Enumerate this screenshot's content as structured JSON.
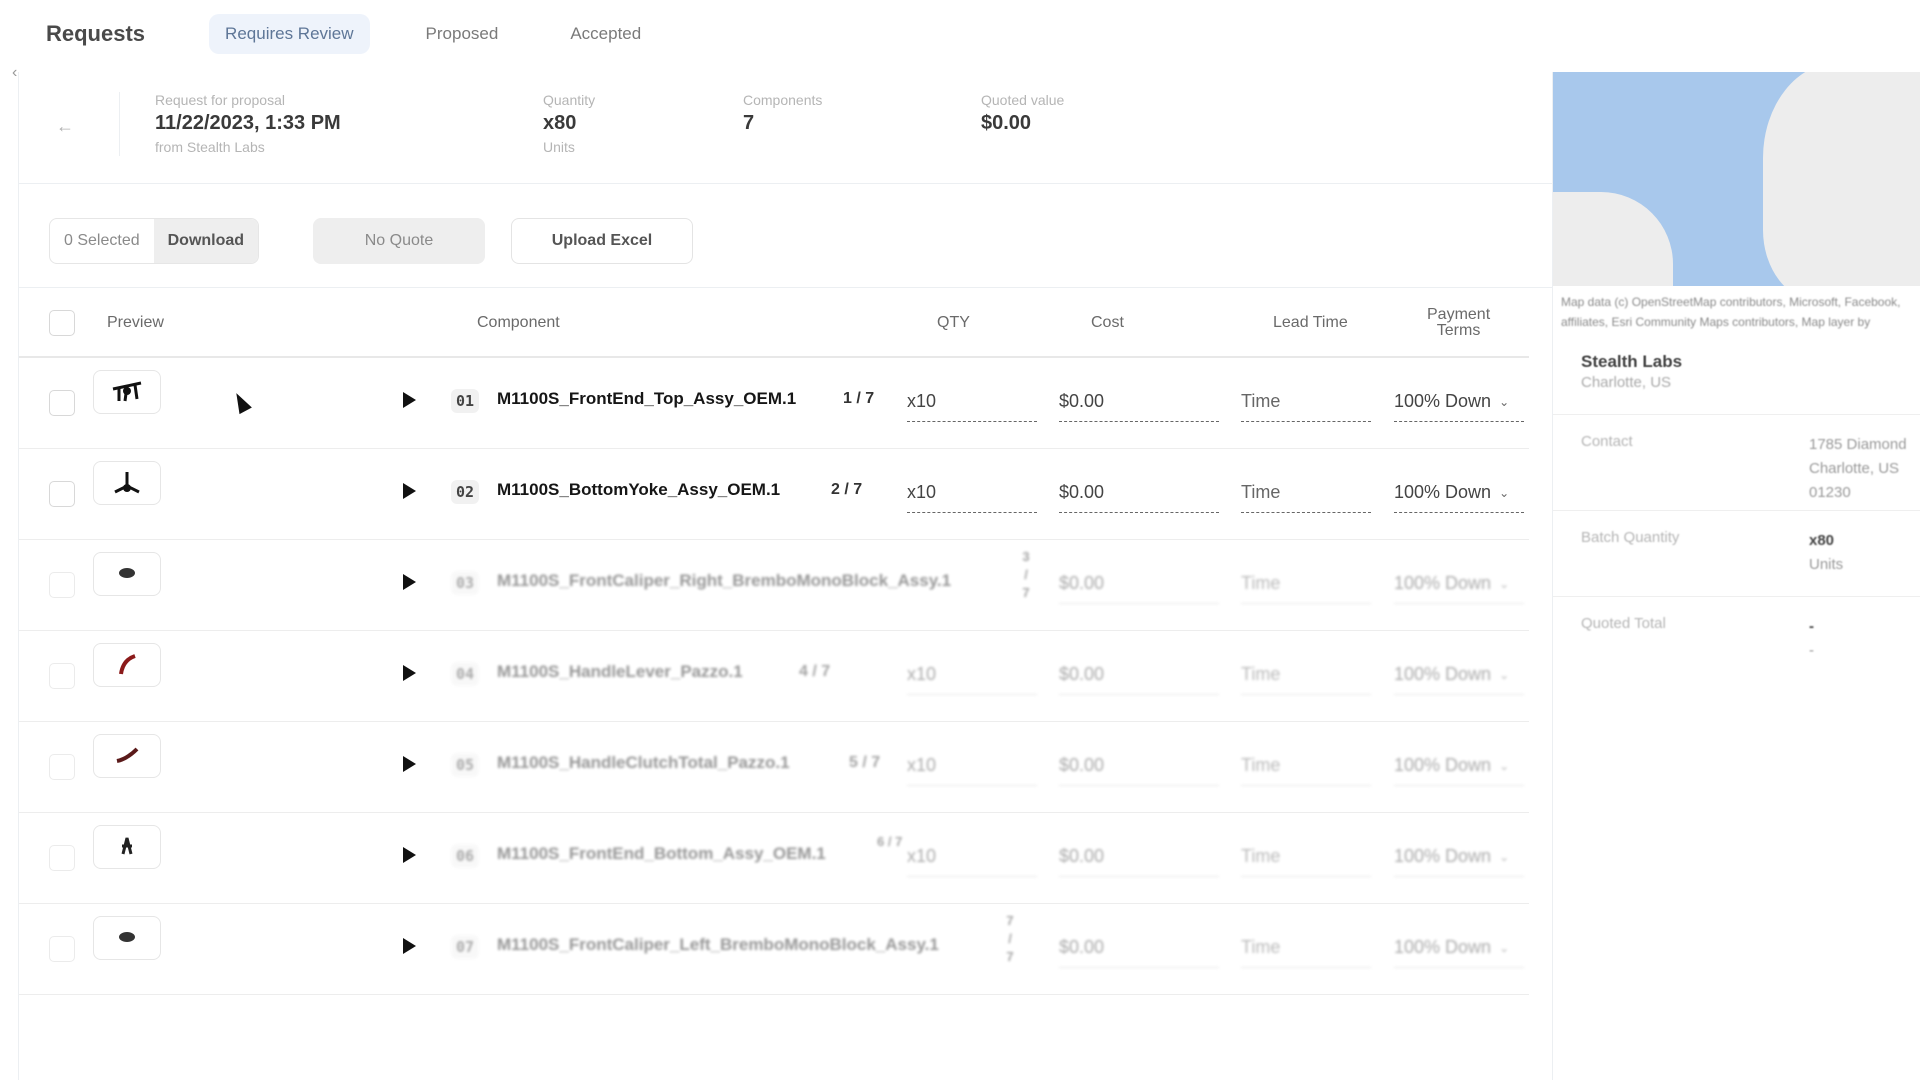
{
  "app": {
    "title": "Requests",
    "tabs": [
      {
        "label": "Requires Review",
        "active": true
      },
      {
        "label": "Proposed",
        "active": false
      },
      {
        "label": "Accepted",
        "active": false
      }
    ]
  },
  "summary": {
    "request": {
      "label": "Request for proposal",
      "value": "11/22/2023, 1:33 PM",
      "sub": "from Stealth Labs"
    },
    "quantity": {
      "label": "Quantity",
      "value": "x80",
      "sub": "Units"
    },
    "components": {
      "label": "Components",
      "value": "7"
    },
    "quoted": {
      "label": "Quoted value",
      "value": "$0.00"
    }
  },
  "toolbar": {
    "selected": "0 Selected",
    "download": "Download",
    "no_quote": "No Quote",
    "upload_excel": "Upload Excel"
  },
  "table": {
    "headers": {
      "preview": "Preview",
      "component": "Component",
      "qty": "QTY",
      "cost": "Cost",
      "lead_time": "Lead Time",
      "payment_terms_1": "Payment",
      "payment_terms_2": "Terms"
    },
    "rows": [
      {
        "index": "01",
        "name": "M1100S_FrontEnd_Top_Assy_OEM.1",
        "count": "1 / 7",
        "qty": "x10",
        "cost": "$0.00",
        "lead": "Time",
        "payment": "100% Down"
      },
      {
        "index": "02",
        "name": "M1100S_BottomYoke_Assy_OEM.1",
        "count": "2 / 7",
        "qty": "x10",
        "cost": "$0.00",
        "lead": "Time",
        "payment": "100% Down"
      },
      {
        "index": "03",
        "name": "M1100S_FrontCaliper_Right_BremboMonoBlock_Assy.1",
        "count": "3 / 7",
        "qty": "x10",
        "cost": "$0.00",
        "lead": "Time",
        "payment": "100% Down"
      },
      {
        "index": "04",
        "name": "M1100S_HandleLever_Pazzo.1",
        "count": "4 / 7",
        "qty": "x10",
        "cost": "$0.00",
        "lead": "Time",
        "payment": "100% Down"
      },
      {
        "index": "05",
        "name": "M1100S_HandleClutchTotal_Pazzo.1",
        "count": "5 / 7",
        "qty": "x10",
        "cost": "$0.00",
        "lead": "Time",
        "payment": "100% Down"
      },
      {
        "index": "06",
        "name": "M1100S_FrontEnd_Bottom_Assy_OEM.1",
        "count": "6 / 7",
        "qty": "x10",
        "cost": "$0.00",
        "lead": "Time",
        "payment": "100% Down"
      },
      {
        "index": "07",
        "name": "M1100S_FrontCaliper_Left_BremboMonoBlock_Assy.1",
        "count": "7 / 7",
        "qty": "x10",
        "cost": "$0.00",
        "lead": "Time",
        "payment": "100% Down"
      }
    ]
  },
  "side": {
    "map_attribution_1": "Map data (c) OpenStreetMap contributors, Microsoft, Facebook,",
    "map_attribution_2": "affiliates, Esri Community Maps contributors, Map layer by",
    "org_name": "Stealth Labs",
    "org_location": "Charlotte, US",
    "contact_label": "Contact",
    "contact_lines": [
      "1785 Diamond",
      "Charlotte, US",
      "01230"
    ],
    "batch_label": "Batch Quantity",
    "batch_value": "x80",
    "batch_sub": "Units",
    "quoted_label": "Quoted Total",
    "quoted_value": "-",
    "quoted_sub": "-"
  },
  "icons": {
    "back": "arrow-left-icon",
    "collapse": "chevron-left-icon",
    "expand": "play-triangle-icon",
    "dropdown": "chevron-down-icon"
  }
}
